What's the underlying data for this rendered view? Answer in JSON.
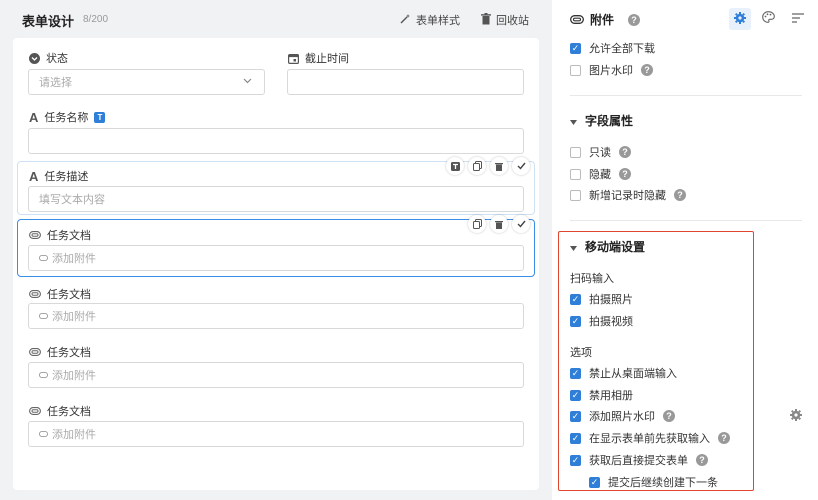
{
  "header": {
    "title": "表单设计",
    "count": "8/200",
    "form_style_label": "表单样式",
    "recycle_label": "回收站"
  },
  "fields": {
    "status": {
      "label": "状态",
      "placeholder": "请选择"
    },
    "deadline": {
      "label": "截止时间"
    },
    "task_name": {
      "label": "任务名称",
      "badge": "T"
    },
    "task_desc": {
      "label": "任务描述",
      "placeholder": "填写文本内容"
    },
    "attachments": [
      {
        "label": "任务文档",
        "placeholder": "添加附件"
      },
      {
        "label": "任务文档",
        "placeholder": "添加附件"
      },
      {
        "label": "任务文档",
        "placeholder": "添加附件"
      },
      {
        "label": "任务文档",
        "placeholder": "添加附件"
      }
    ]
  },
  "panel": {
    "title": "附件",
    "top_options": [
      {
        "label": "允许全部下载",
        "checked": true
      },
      {
        "label": "图片水印",
        "checked": false,
        "help": true
      }
    ],
    "field_props": {
      "title": "字段属性",
      "options": [
        {
          "label": "只读",
          "checked": false,
          "help": true
        },
        {
          "label": "隐藏",
          "checked": false,
          "help": true
        },
        {
          "label": "新增记录时隐藏",
          "checked": false,
          "help": true
        }
      ]
    },
    "mobile": {
      "title": "移动端设置",
      "scan_title": "扫码输入",
      "scan_options": [
        {
          "label": "拍摄照片",
          "checked": true
        },
        {
          "label": "拍摄视频",
          "checked": true
        }
      ],
      "options_title": "选项",
      "options": [
        {
          "label": "禁止从桌面端输入",
          "checked": true
        },
        {
          "label": "禁用相册",
          "checked": true
        },
        {
          "label": "添加照片水印",
          "checked": true,
          "help": true
        },
        {
          "label": "在显示表单前先获取输入",
          "checked": true,
          "help": true
        },
        {
          "label": "获取后直接提交表单",
          "checked": true,
          "help": true
        },
        {
          "label": "提交后继续创建下一条",
          "checked": true
        }
      ]
    }
  },
  "colors": {
    "accent": "#2f7fd8",
    "highlight": "#e0452f",
    "selected_border": "#3b8ee6"
  }
}
